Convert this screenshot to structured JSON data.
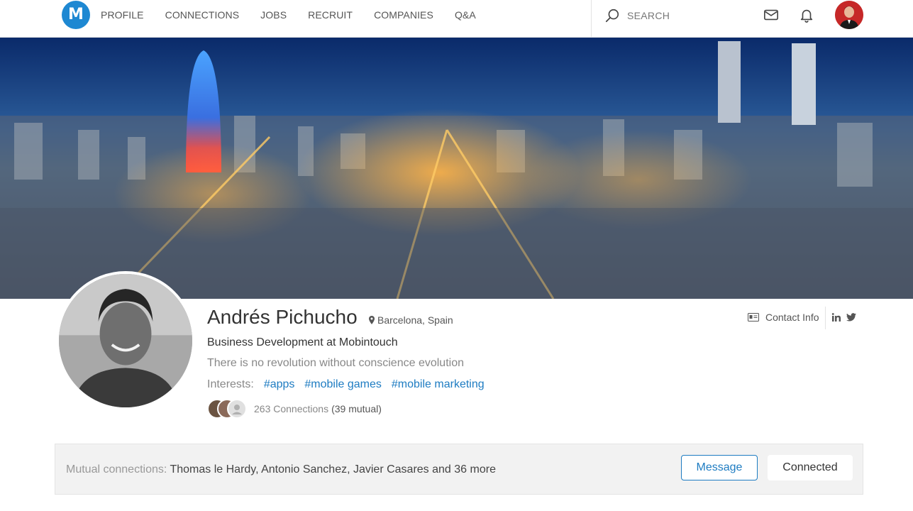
{
  "header": {
    "logo_letter": "M",
    "nav": [
      "PROFILE",
      "CONNECTIONS",
      "JOBS",
      "RECRUIT",
      "COMPANIES",
      "Q&A"
    ],
    "search_placeholder": "SEARCH",
    "icons": [
      "search-icon",
      "mail-icon",
      "bell-icon",
      "avatar"
    ]
  },
  "profile": {
    "name": "Andrés Pichucho",
    "location": "Barcelona, Spain",
    "headline": "Business Development at Mobintouch",
    "motto": "There is no revolution without conscience evolution",
    "interests_label": "Interests:",
    "interests": [
      "#apps",
      "#mobile games",
      "#mobile marketing"
    ],
    "connections_count": "263 Connections",
    "connections_mutual": "(39 mutual)",
    "contact_info_label": "Contact Info",
    "social_icons": [
      "linkedin-icon",
      "twitter-icon"
    ]
  },
  "mutual": {
    "label": "Mutual connections:",
    "names": "Thomas le Hardy, Antonio Sanchez, Javier Casares and 36 more",
    "message_button": "Message",
    "connected_button": "Connected"
  },
  "colors": {
    "brand": "#1e88d2",
    "link": "#1e7cc2",
    "mutual_bar_bg": "#f2f2f2"
  }
}
